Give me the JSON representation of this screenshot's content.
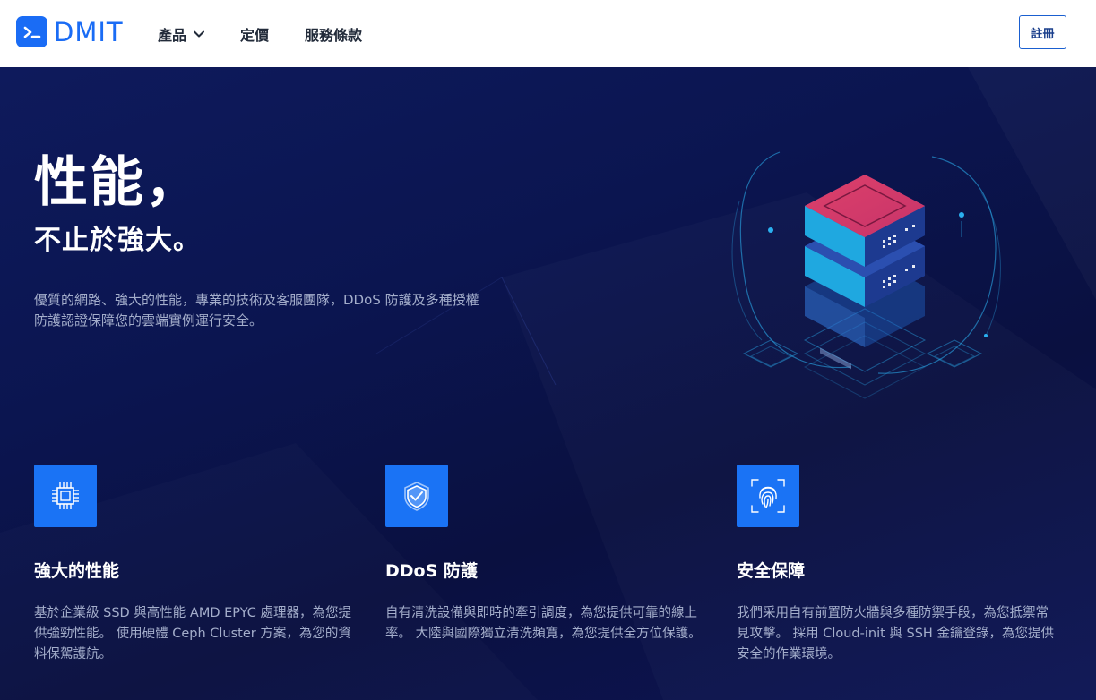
{
  "header": {
    "logo_text": "DMIT",
    "nav": [
      {
        "label": "產品",
        "has_dropdown": true
      },
      {
        "label": "定價",
        "has_dropdown": false
      },
      {
        "label": "服務條款",
        "has_dropdown": false
      }
    ],
    "register_label": "註冊"
  },
  "hero": {
    "title": "性能，",
    "subtitle": "不止於強大。",
    "description": "優質的網路、強大的性能，專業的技術及客服團隊，DDoS 防護及多種授權防護認證保障您的雲端實例運行安全。"
  },
  "features": [
    {
      "icon": "cpu-chip-icon",
      "title": "強大的性能",
      "description": "基於企業級 SSD 與高性能 AMD EPYC 處理器，為您提供強勁性能。 使用硬體 Ceph Cluster 方案，為您的資料保駕護航。"
    },
    {
      "icon": "shield-check-icon",
      "title": "DDoS 防護",
      "description": "自有清洗設備與即時的牽引調度，為您提供可靠的線上率。 大陸與國際獨立清洗頻寬，為您提供全方位保護。"
    },
    {
      "icon": "fingerprint-icon",
      "title": "安全保障",
      "description": "我們采用自有前置防火牆與多種防禦手段，為您抵禦常見攻擊。 採用 Cloud-init 與 SSH 金鑰登錄，為您提供安全的作業環境。"
    }
  ],
  "colors": {
    "brand_blue": "#1a6cf5",
    "hero_bg": "#0b1550",
    "icon_tile": "#1a73f5",
    "server_top": "#d63a6a",
    "server_side": "#1fa8e0"
  }
}
